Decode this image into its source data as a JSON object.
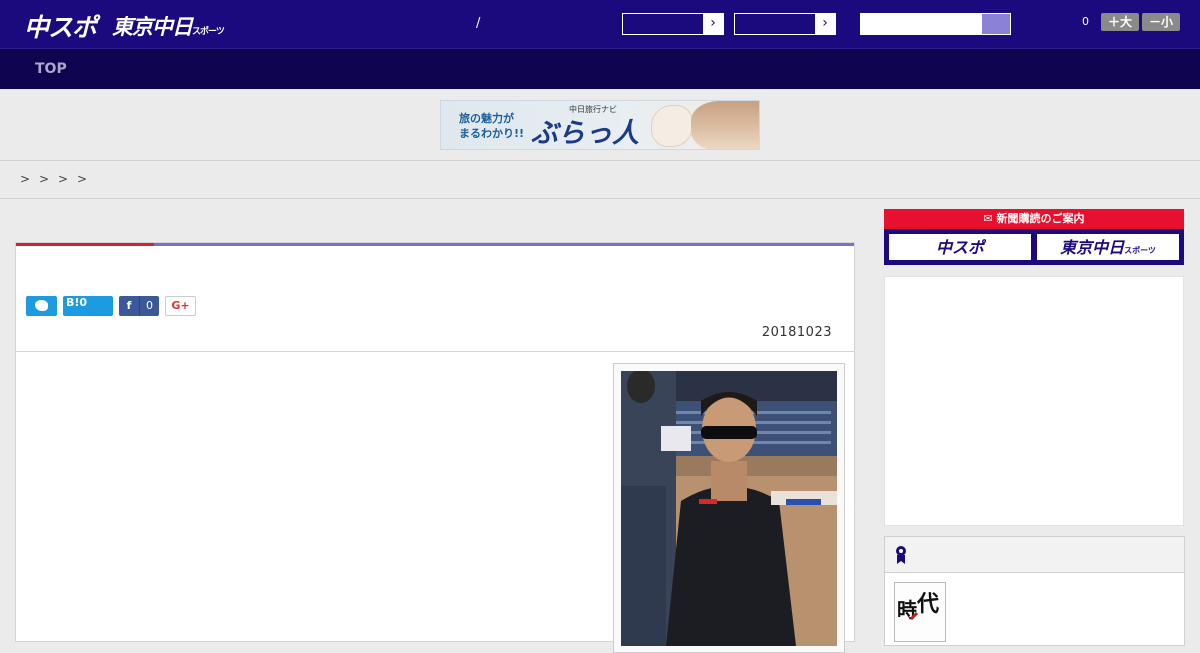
{
  "header": {
    "logo_primary": "中スポ",
    "logo_secondary": "東京中日",
    "logo_secondary_small": "スポーツ",
    "separator": "/",
    "select_a_arrow": "›",
    "select_b_arrow": "›",
    "font_count": "0",
    "font_bigger": "＋大",
    "font_smaller": "－小"
  },
  "nav": {
    "items": [
      {
        "label": "TOP"
      }
    ]
  },
  "banner": {
    "line1": "旅の魅力が",
    "line2": "まるわかり!!",
    "small_title": "中日旅行ナビ",
    "brand": "ぶらっ人"
  },
  "breadcrumb": {
    "separators": [
      ">",
      ">",
      ">",
      ">"
    ]
  },
  "article": {
    "share": {
      "hatena_label": "B!",
      "hatena_count": "0",
      "facebook_icon": "f",
      "facebook_count": "0",
      "gplus_label": "G+"
    },
    "date": "20181023"
  },
  "sidebar": {
    "subscribe_title": "新聞購読のご案内",
    "subscribe_options": [
      "中スポ",
      "東京中日"
    ],
    "subscribe_option_small": "スポーツ"
  },
  "colors": {
    "header_bg": "#1a0a7e",
    "nav_bg": "#0e0450",
    "accent_red": "#d81e32",
    "accent_purple": "#7a6fd0",
    "twitter": "#1d9be0",
    "facebook": "#3b5998"
  },
  "icons": {
    "twitter": "twitter-bird-icon",
    "hatena": "hatena-bookmark-icon",
    "facebook": "facebook-icon",
    "gplus": "google-plus-icon",
    "ranking": "medal-icon",
    "subscribe": "newspaper-icon",
    "dropdown": "chevron-right-icon"
  }
}
